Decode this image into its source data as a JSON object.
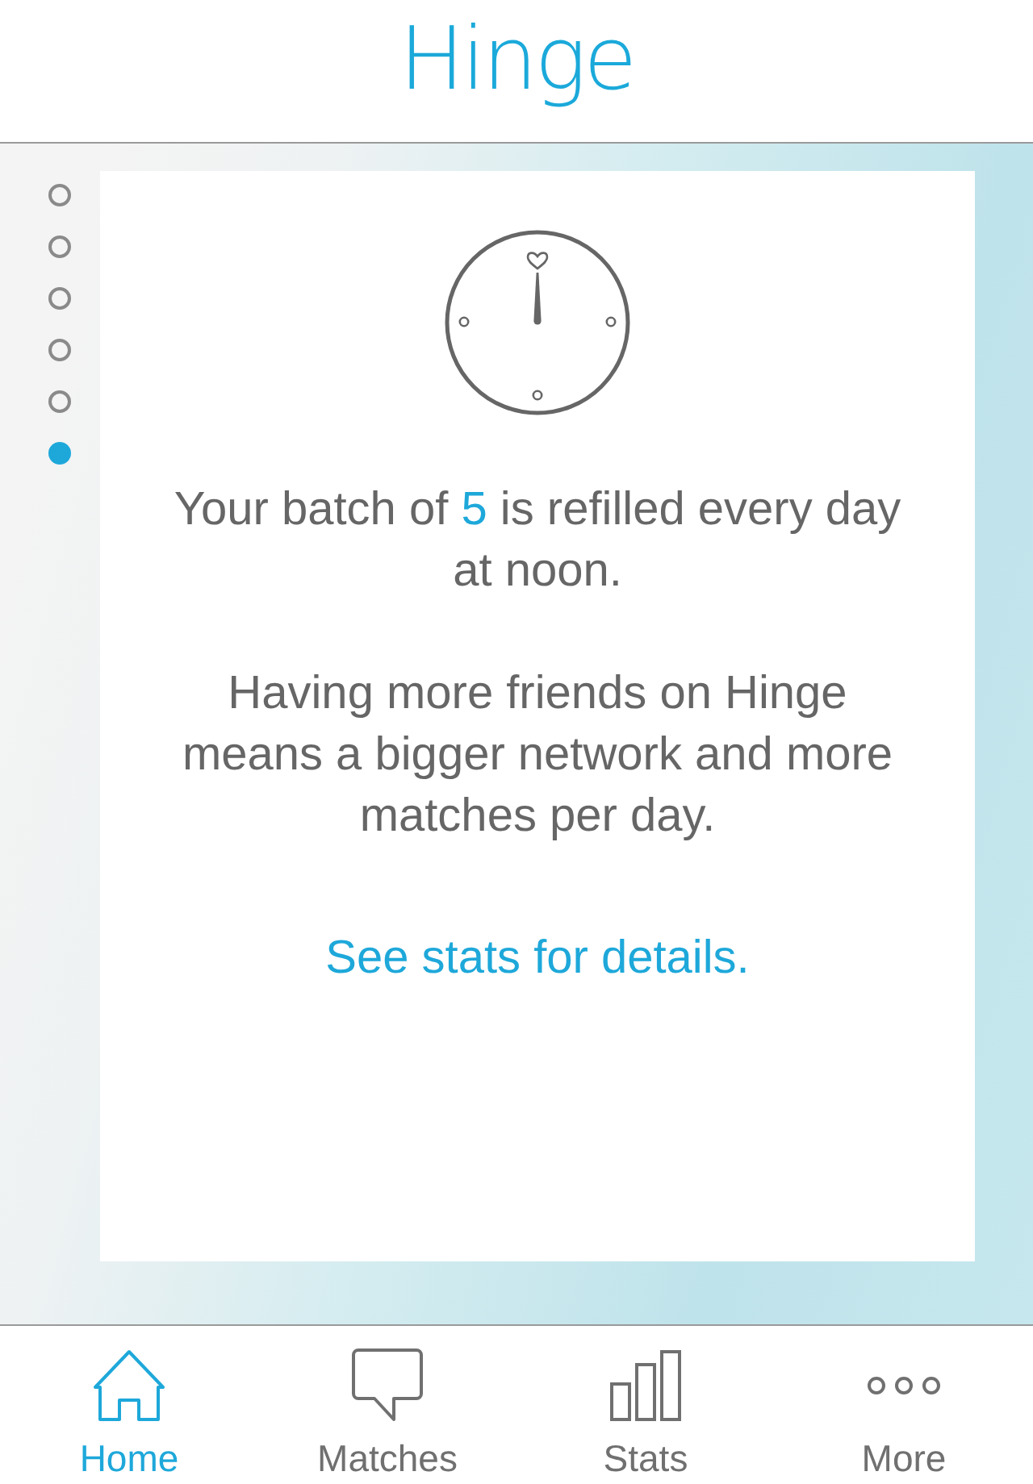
{
  "header": {
    "logo": "Hinge"
  },
  "pages": [
    {
      "selected": false
    },
    {
      "selected": false
    },
    {
      "selected": false
    },
    {
      "selected": false
    },
    {
      "selected": false
    },
    {
      "selected": true
    }
  ],
  "card": {
    "batch_text": {
      "prefix": "Your batch of ",
      "count": "5",
      "suffix": " is refilled every day at noon."
    },
    "network_text": "Having more friends on Hinge means a bigger network and more matches per day.",
    "stats_link": "See stats for details."
  },
  "tabs": [
    {
      "kind": "home",
      "label": "Home",
      "selected": true
    },
    {
      "kind": "matches",
      "label": "Matches",
      "selected": false
    },
    {
      "kind": "stats",
      "label": "Stats",
      "selected": false
    },
    {
      "kind": "more",
      "label": "More",
      "selected": false
    }
  ]
}
